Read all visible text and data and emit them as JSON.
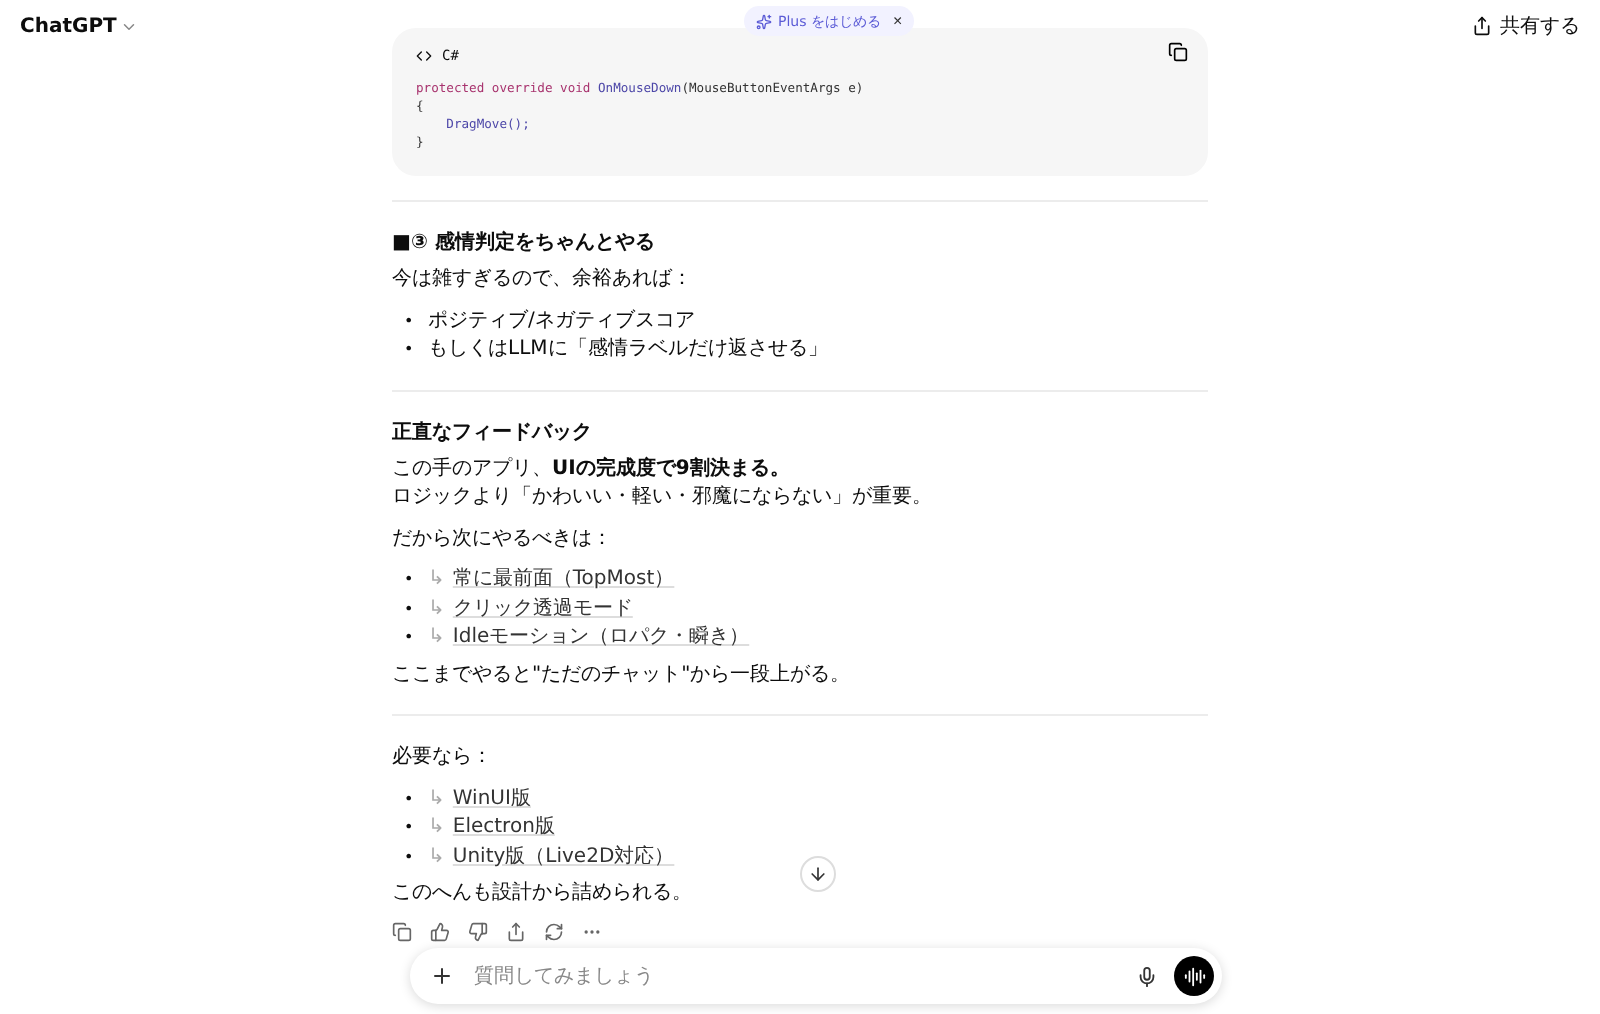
{
  "header": {
    "title": "ChatGPT",
    "share": "共有する"
  },
  "promo": {
    "label": "Plus をはじめる",
    "close": "×"
  },
  "code_block": {
    "language": "C#",
    "lines": [
      {
        "kind": "signature",
        "keywords": "protected override void ",
        "name": "OnMouseDown",
        "args": "(MouseButtonEventArgs e)"
      },
      {
        "kind": "plain",
        "text": "{"
      },
      {
        "kind": "call",
        "text": "    DragMove();"
      },
      {
        "kind": "plain",
        "text": "}"
      }
    ]
  },
  "sections": [
    {
      "kind": "section",
      "heading": "■③ 感情判定をちゃんとやる",
      "blocks": [
        {
          "kind": "para",
          "lines": [
            "今は雑すぎるので、余裕あれば："
          ]
        },
        {
          "kind": "list",
          "items": [
            {
              "bullet": "•",
              "text": "ポジティブ/ネガティブスコア"
            },
            {
              "bullet": "•",
              "text": "もしくはLLMに「感情ラベルだけ返させる」"
            }
          ]
        }
      ]
    },
    {
      "kind": "section",
      "heading": "正直なフィードバック",
      "blocks": [
        {
          "kind": "para",
          "lines": [
            "この手のアプリ、**UIの完成度で9割決まる。**",
            "ロジックより「かわいい・軽い・邪魔にならない」が重要。"
          ]
        },
        {
          "kind": "para",
          "lines": [
            "だから次にやるべきは："
          ]
        },
        {
          "kind": "links",
          "items": [
            {
              "bullet": "•",
              "arrow": "↳",
              "text": "常に最前面（TopMost）"
            },
            {
              "bullet": "•",
              "arrow": "↳",
              "text": "クリック透過モード"
            },
            {
              "bullet": "•",
              "arrow": "↳",
              "text": "Idleモーション（ロパク・瞬き）"
            }
          ]
        },
        {
          "kind": "para",
          "lines": [
            "ここまでやると\"ただのチャット\"から一段上がる。"
          ]
        }
      ]
    },
    {
      "kind": "section",
      "blocks": [
        {
          "kind": "para",
          "lines": [
            "必要なら："
          ]
        },
        {
          "kind": "links",
          "items": [
            {
              "bullet": "•",
              "arrow": "↳",
              "text": "WinUI版"
            },
            {
              "bullet": "•",
              "arrow": "↳",
              "text": "Electron版"
            },
            {
              "bullet": "•",
              "arrow": "↳",
              "text": "Unity版（Live2D対応）"
            }
          ]
        },
        {
          "kind": "para",
          "lines": [
            "このへんも設計から詰められる。"
          ]
        }
      ]
    }
  ],
  "composer": {
    "placeholder": "質問してみましょう"
  }
}
